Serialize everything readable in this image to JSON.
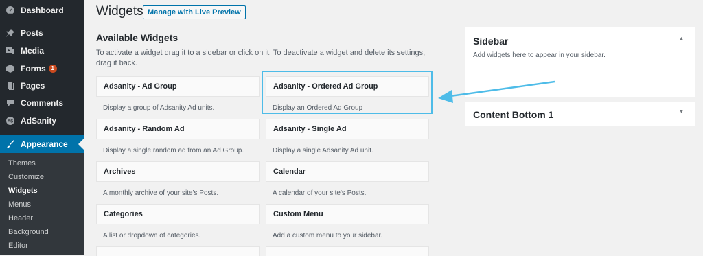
{
  "colors": {
    "accent": "#0073aa",
    "annotation": "#4ebce8",
    "sidebar_bg": "#23282d"
  },
  "admin_menu": {
    "items": [
      {
        "label": "Dashboard",
        "icon": "dashboard-icon"
      },
      {
        "label": "Posts",
        "icon": "pin-icon"
      },
      {
        "label": "Media",
        "icon": "media-icon"
      },
      {
        "label": "Forms",
        "icon": "forms-icon",
        "badge": "1"
      },
      {
        "label": "Pages",
        "icon": "pages-icon"
      },
      {
        "label": "Comments",
        "icon": "comments-icon"
      },
      {
        "label": "AdSanity",
        "icon": "adsanity-icon"
      },
      {
        "label": "Appearance",
        "icon": "appearance-icon"
      }
    ],
    "submenu": [
      "Themes",
      "Customize",
      "Widgets",
      "Menus",
      "Header",
      "Background",
      "Editor"
    ]
  },
  "header": {
    "title": "Widgets",
    "live_preview": "Manage with Live Preview"
  },
  "available": {
    "title": "Available Widgets",
    "description": "To activate a widget drag it to a sidebar or click on it. To deactivate a widget and delete its settings, drag it back."
  },
  "widgets": [
    {
      "title": "Adsanity - Ad Group",
      "desc": "Display a group of Adsanity Ad units."
    },
    {
      "title": "Adsanity - Ordered Ad Group",
      "desc": "Display an Ordered Ad Group"
    },
    {
      "title": "Adsanity - Random Ad",
      "desc": "Display a single random ad from an Ad Group."
    },
    {
      "title": "Adsanity - Single Ad",
      "desc": "Display a single Adsanity Ad unit."
    },
    {
      "title": "Archives",
      "desc": "A monthly archive of your site's Posts."
    },
    {
      "title": "Calendar",
      "desc": "A calendar of your site's Posts."
    },
    {
      "title": "Categories",
      "desc": "A list or dropdown of categories."
    },
    {
      "title": "Custom Menu",
      "desc": "Add a custom menu to your sidebar."
    }
  ],
  "sidebars": [
    {
      "title": "Sidebar",
      "desc": "Add widgets here to appear in your sidebar.",
      "arrow": "▲"
    },
    {
      "title": "Content Bottom 1",
      "arrow": "▼"
    }
  ]
}
